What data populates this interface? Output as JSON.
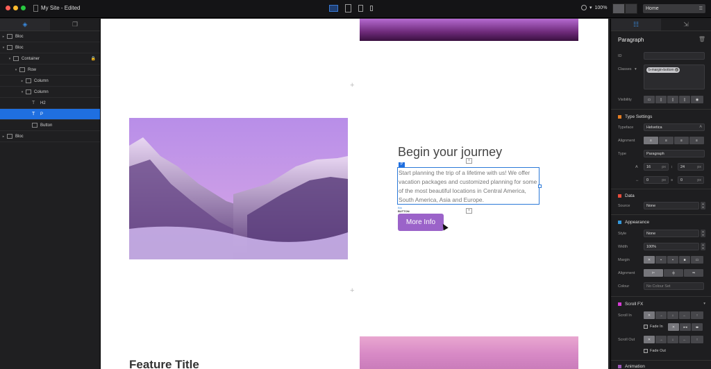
{
  "titlebar": {
    "title": "My Site - Edited",
    "zoom": "100%",
    "page_select": "Home",
    "traffic_lights": [
      "#ff5f57",
      "#febc2e",
      "#28c840"
    ],
    "device_icons": [
      "desktop-icon",
      "tablet-landscape-icon",
      "tablet-portrait-icon",
      "phone-icon"
    ]
  },
  "layers": {
    "items": [
      {
        "label": "Bloc",
        "indent": 0,
        "tri": "▸"
      },
      {
        "label": "Bloc",
        "indent": 0,
        "tri": "▾"
      },
      {
        "label": "Container",
        "indent": 1,
        "tri": "▾"
      },
      {
        "label": "Row",
        "indent": 2,
        "tri": "▾"
      },
      {
        "label": "Column",
        "indent": 3,
        "tri": "▸"
      },
      {
        "label": "Column",
        "indent": 3,
        "tri": "▾"
      },
      {
        "label": "H2",
        "indent": 4,
        "tri": ""
      },
      {
        "label": "P",
        "indent": 4,
        "tri": ""
      },
      {
        "label": "Button",
        "indent": 4,
        "tri": ""
      },
      {
        "label": "Bloc",
        "indent": 0,
        "tri": "▸"
      }
    ],
    "selected_index": 7
  },
  "canvas": {
    "heading": "Begin your journey",
    "p_tag": "P",
    "paragraph": "Start planning the trip of a lifetime with us! We offer vacation packages and customized planning for some of the most beautiful locations in Central America, South America, Asia and Europe.",
    "btn_label_a": "Btn",
    "btn_label_b": "BUTTON",
    "more_button": "More Info",
    "feature_title": "Feature Title",
    "add_glyph": "+"
  },
  "inspector": {
    "title": "Paragraph",
    "id_label": "ID",
    "id_value": "",
    "classes_label": "Classes",
    "class_chip": "b-margin-bottom",
    "visibility_label": "Visibility",
    "type_settings": {
      "title": "Type Settings",
      "color": "#e67e22",
      "typeface_label": "Typeface",
      "typeface_value": "Helvetica",
      "alignment_label": "Alignment",
      "type_label": "Type",
      "type_value": "Paragraph",
      "font_size": "16",
      "font_unit": "px",
      "line_height": "24",
      "line_unit": "px",
      "letter_spacing": "0",
      "letter_unit": "px",
      "word_spacing": "0",
      "word_unit": "px"
    },
    "data": {
      "title": "Data",
      "color": "#e74c3c",
      "source_label": "Source",
      "source_value": "None"
    },
    "appearance": {
      "title": "Appearance",
      "color": "#3498db",
      "style_label": "Style",
      "style_value": "None",
      "width_label": "Width",
      "width_value": "100%",
      "margin_label": "Margin",
      "alignment_label": "Alignment",
      "colour_label": "Colour",
      "colour_value": "No Colour Set"
    },
    "scroll_fx": {
      "title": "Scroll FX",
      "color": "#d63cd6",
      "scroll_in_label": "Scroll In",
      "fade_in": "Fade In",
      "scroll_out_label": "Scroll Out",
      "fade_out": "Fade Out"
    },
    "animation": {
      "title": "Animation",
      "color": "#9b59b6"
    }
  }
}
